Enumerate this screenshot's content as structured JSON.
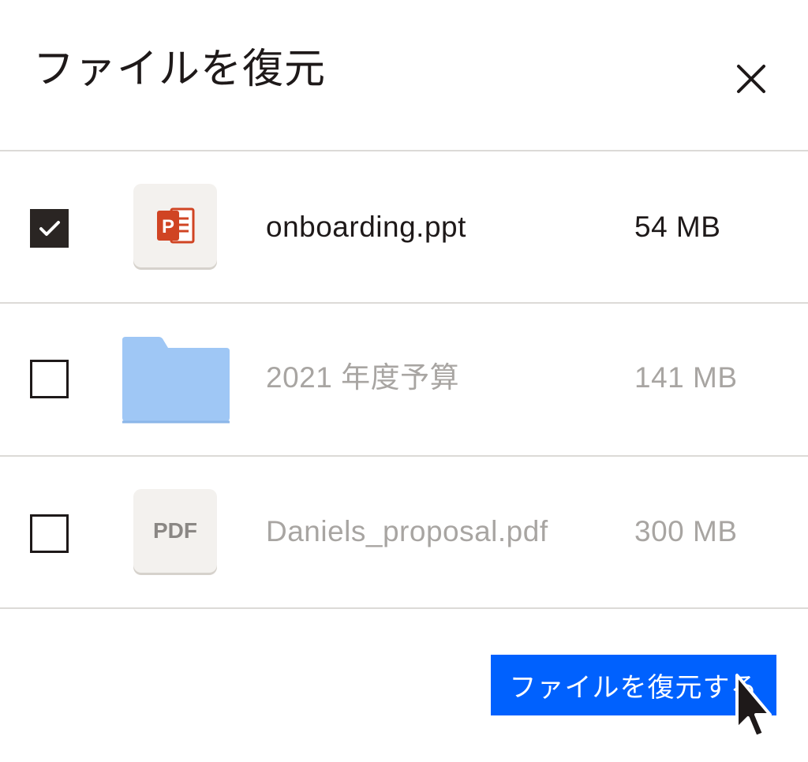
{
  "dialog": {
    "title": "ファイルを復元",
    "close_icon": "close-icon"
  },
  "files": [
    {
      "name": "onboarding.ppt",
      "size": "54 MB",
      "checked": true,
      "icon": "powerpoint-file-icon",
      "icon_color": "#d04423"
    },
    {
      "name": "2021 年度予算",
      "size": "141 MB",
      "checked": false,
      "icon": "folder-icon",
      "icon_color": "#9fc7f5"
    },
    {
      "name": "Daniels_proposal.pdf",
      "size": "300 MB",
      "checked": false,
      "icon": "pdf-file-icon",
      "icon_label": "PDF"
    }
  ],
  "footer": {
    "restore_label": "ファイルを復元する"
  },
  "colors": {
    "accent": "#0061fe",
    "checkbox_checked": "#2a2523",
    "text_primary": "#1e1919",
    "text_muted": "#a8a5a2",
    "divider": "#dcdad7"
  }
}
